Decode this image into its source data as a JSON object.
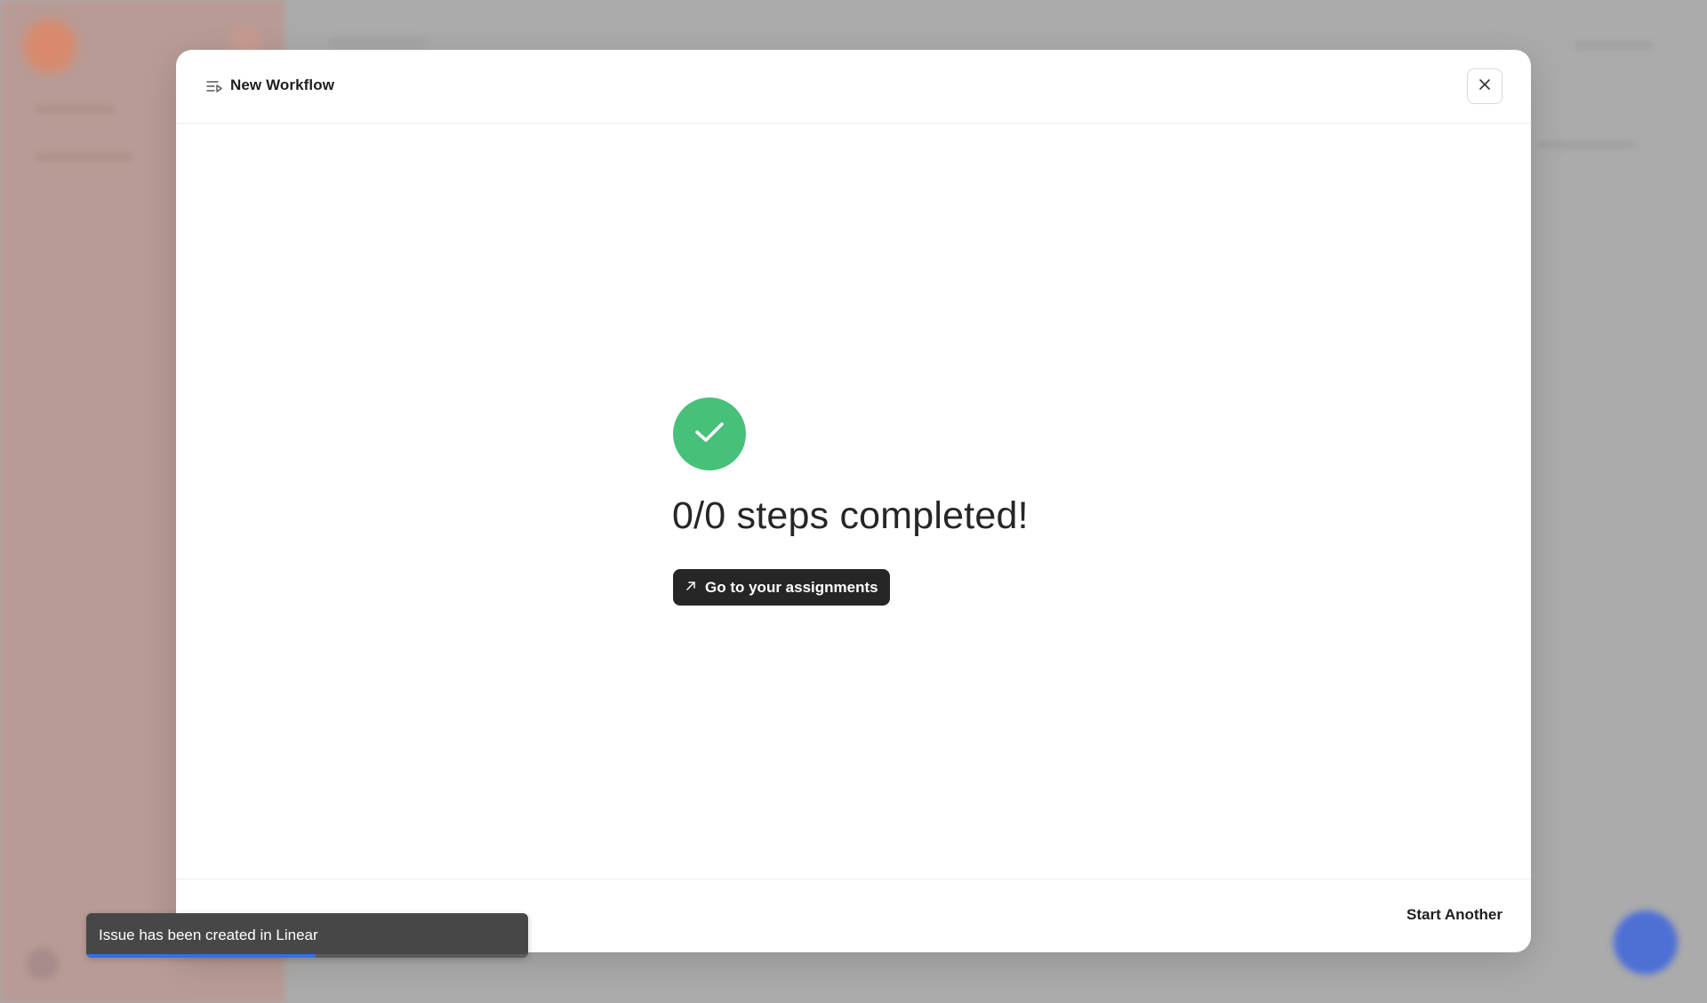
{
  "modal": {
    "title": "New Workflow",
    "title_icon": "workflow-list-icon",
    "close_icon": "close-icon",
    "success_icon": "checkmark-icon",
    "success_color": "#47c07a",
    "status_text": "0/0 steps completed!",
    "assignments_button": {
      "label": "Go to your assignments",
      "icon": "arrow-up-right-icon"
    },
    "start_another_label": "Start Another"
  },
  "toast": {
    "message": "Issue has been created in Linear",
    "progress": 0.52,
    "progress_color": "#2f6ff0"
  }
}
